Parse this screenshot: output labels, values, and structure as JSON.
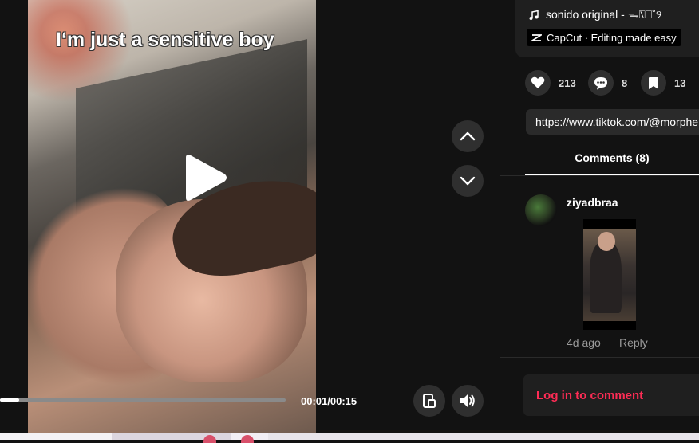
{
  "video": {
    "caption": "I‘m just a sensitive boy",
    "time": "00:01/00:15",
    "progress_fraction": 0.066
  },
  "sidebar": {
    "music": "sonido original - ᯓ⍂⎕˚୨",
    "capcut": "CapCut · Editing made easy",
    "likes": "213",
    "comments_count": "8",
    "saves": "13",
    "link": "https://www.tiktok.com/@morphe",
    "comments_tab": "Comments (8)",
    "comment": {
      "username": "ziyadbraa",
      "time": "4d ago",
      "reply": "Reply"
    },
    "login": "Log in to comment"
  },
  "colors": {
    "accent": "#fe2c55",
    "background": "#121212",
    "button": "#2f2f2f"
  }
}
